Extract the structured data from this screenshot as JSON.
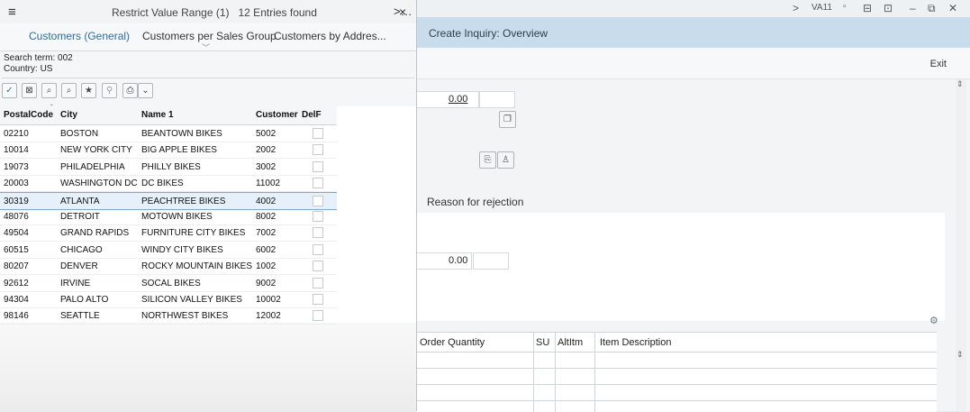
{
  "background_window": {
    "topbar": {
      "nav_arrow": ">",
      "transaction": "VA11"
    },
    "title": "Create Inquiry: Overview",
    "exit_label": "Exit",
    "field_value_1": "0.00",
    "field_value_2": "0.00",
    "rejection_label": "Reason for rejection",
    "table_headers": {
      "order_quantity": "Order Quantity",
      "su": "SU",
      "altitm": "AltItm",
      "item_description": "Item Description"
    }
  },
  "dialog": {
    "title": "Restrict Value Range (1)   12 Entries found",
    "close": "×",
    "menu": "≡",
    "tabs": [
      "Customers (General)",
      "Customers per Sales Group",
      "Customers by Addres..."
    ],
    "tab_more": ">…",
    "search_term": "Search term: 002",
    "country": "Country: US",
    "columns": [
      "PostalCode",
      "City",
      "Name 1",
      "Customer",
      "DelF"
    ],
    "rows": [
      {
        "postal": "02210",
        "city": "BOSTON",
        "name": "BEANTOWN BIKES",
        "customer": "5002"
      },
      {
        "postal": "10014",
        "city": "NEW YORK CITY",
        "name": "BIG APPLE BIKES",
        "customer": "2002"
      },
      {
        "postal": "19073",
        "city": "PHILADELPHIA",
        "name": "PHILLY BIKES",
        "customer": "3002"
      },
      {
        "postal": "20003",
        "city": "WASHINGTON DC",
        "name": "DC BIKES",
        "customer": "11002"
      },
      {
        "postal": "30319",
        "city": "ATLANTA",
        "name": "PEACHTREE BIKES",
        "customer": "4002"
      },
      {
        "postal": "48076",
        "city": "DETROIT",
        "name": "MOTOWN BIKES",
        "customer": "8002"
      },
      {
        "postal": "49504",
        "city": "GRAND RAPIDS",
        "name": "FURNITURE CITY BIKES",
        "customer": "7002"
      },
      {
        "postal": "60515",
        "city": "CHICAGO",
        "name": "WINDY CITY BIKES",
        "customer": "6002"
      },
      {
        "postal": "80207",
        "city": "DENVER",
        "name": "ROCKY MOUNTAIN BIKES",
        "customer": "1002"
      },
      {
        "postal": "92612",
        "city": "IRVINE",
        "name": "SOCAL BIKES",
        "customer": "9002"
      },
      {
        "postal": "94304",
        "city": "PALO ALTO",
        "name": "SILICON VALLEY BIKES",
        "customer": "10002"
      },
      {
        "postal": "98146",
        "city": "SEATTLE",
        "name": "NORTHWEST BIKES",
        "customer": "12002"
      }
    ],
    "selected_row": 4
  }
}
